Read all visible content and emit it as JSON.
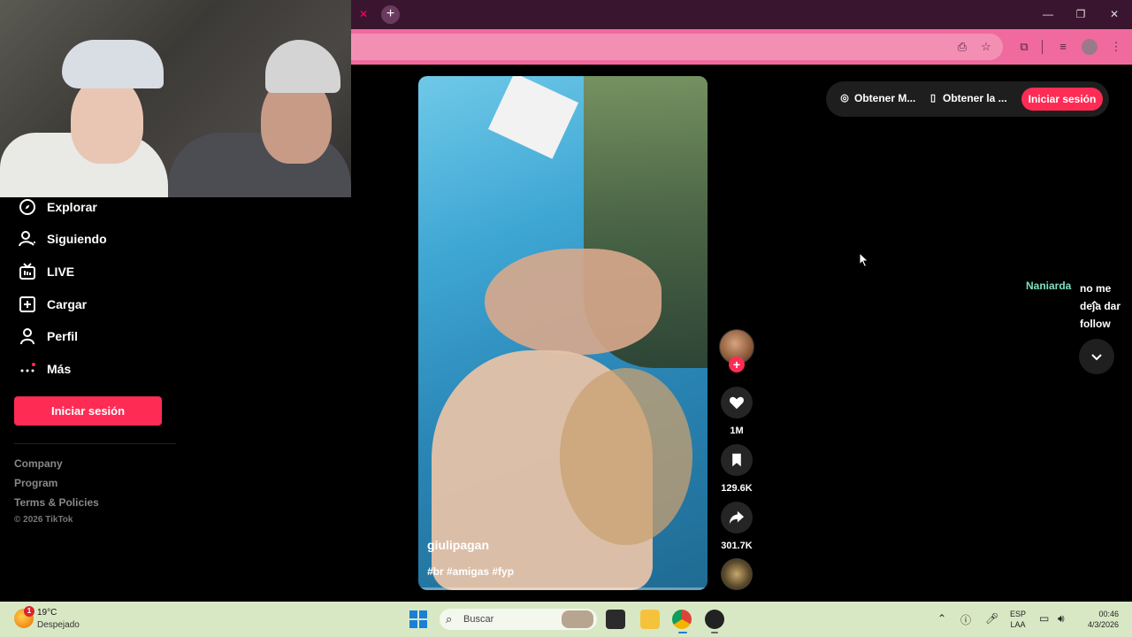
{
  "browser": {
    "tab_close": "✕",
    "new_tab": "+",
    "window_controls": {
      "minimize": "—",
      "maximize": "❐",
      "close": "✕"
    }
  },
  "sidebar": {
    "items": [
      {
        "label": "Explorar",
        "icon": "compass-icon"
      },
      {
        "label": "Siguiendo",
        "icon": "user-follow-icon"
      },
      {
        "label": "LIVE",
        "icon": "live-tv-icon"
      },
      {
        "label": "Cargar",
        "icon": "upload-plus-icon"
      },
      {
        "label": "Perfil",
        "icon": "person-icon"
      },
      {
        "label": "Más",
        "icon": "more-dots-icon"
      }
    ],
    "login_button": "Iniciar sesión",
    "footer": {
      "company": "Company",
      "program": "Program",
      "terms": "Terms & Policies",
      "copyright": "© 2026 TikTok"
    }
  },
  "video": {
    "username": "giulipagan",
    "hashtags": "#br #amigas #fyp"
  },
  "actions": {
    "likes": "1M",
    "saves": "129.6K",
    "shares": "301.7K"
  },
  "top_bar": {
    "get_app_1": "Obtener M...",
    "get_app_2": "Obtener la ...",
    "login": "Iniciar sesión"
  },
  "live_comment": {
    "user": "Naniarda",
    "text": "no me deja dar follow"
  },
  "taskbar": {
    "temperature": "19°C",
    "condition": "Despejado",
    "weather_badge": "1",
    "search_placeholder": "Buscar",
    "language_1": "ESP",
    "language_2": "LAA",
    "time": "00:46",
    "date": "4/3/2026"
  },
  "colors": {
    "accent": "#fe2c55",
    "address_bar": "#f06a9e",
    "tab_bar": "#3a1530",
    "taskbar": "#d9e8c4",
    "comment_user": "#7ee0c4"
  }
}
